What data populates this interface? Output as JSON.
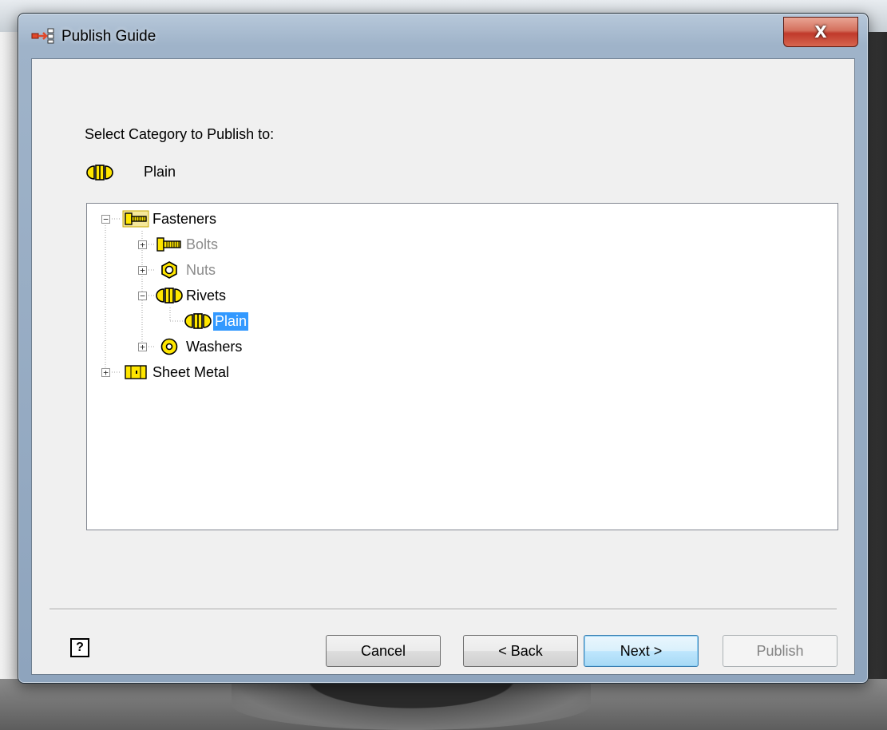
{
  "window": {
    "title": "Publish Guide",
    "close_glyph": "X",
    "title_icon": "publish-guide-icon"
  },
  "prompt": "Select Category to Publish to:",
  "selected_category": {
    "icon": "rivet-icon",
    "label": "Plain"
  },
  "tree": {
    "nodes": [
      {
        "label": "Fasteners",
        "icon": "fastener-icon",
        "expander": "−",
        "state": "normal"
      },
      {
        "label": "Bolts",
        "icon": "bolt-icon",
        "expander": "+",
        "state": "disabled"
      },
      {
        "label": "Nuts",
        "icon": "nut-icon",
        "expander": "+",
        "state": "disabled"
      },
      {
        "label": "Rivets",
        "icon": "rivet-icon",
        "expander": "−",
        "state": "normal"
      },
      {
        "label": "Plain",
        "icon": "rivet-icon",
        "expander": "",
        "state": "selected"
      },
      {
        "label": "Washers",
        "icon": "washer-icon",
        "expander": "+",
        "state": "normal"
      },
      {
        "label": "Sheet Metal",
        "icon": "sheet-metal-icon",
        "expander": "+",
        "state": "normal"
      }
    ]
  },
  "buttons": {
    "help": "?",
    "cancel": "Cancel",
    "back": "< Back",
    "next": "Next >",
    "publish": "Publish"
  },
  "colors": {
    "selection": "#3399ff",
    "icon_yellow": "#ffe600",
    "close_red": "#c0392b"
  }
}
